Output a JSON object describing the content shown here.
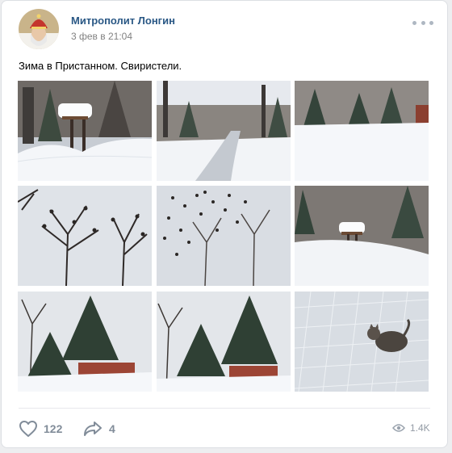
{
  "post": {
    "author": "Митрополит Лонгин",
    "date": "3 фев в 21:04",
    "text": "Зима в Пристанном. Свиристели."
  },
  "photos": [
    {
      "scene": "snow-covered bird feeder and trees"
    },
    {
      "scene": "snowy garden path between trees"
    },
    {
      "scene": "snowy park with fir trees"
    },
    {
      "scene": "bare tree with perched birds"
    },
    {
      "scene": "flock of birds over bare trees"
    },
    {
      "scene": "snow-covered bird feeder among pines"
    },
    {
      "scene": "fir trees with red roof"
    },
    {
      "scene": "fir trees with red roof (wide)"
    },
    {
      "scene": "cat on snowy paving stones"
    }
  ],
  "actions": {
    "likes": "122",
    "shares": "4",
    "views": "1.4K"
  },
  "colors": {
    "author": "#2a5885",
    "icon": "#818c99",
    "background": "#edeef0"
  },
  "icons": [
    "heart-icon",
    "share-arrow-icon",
    "eye-icon",
    "more-dots-icon"
  ]
}
